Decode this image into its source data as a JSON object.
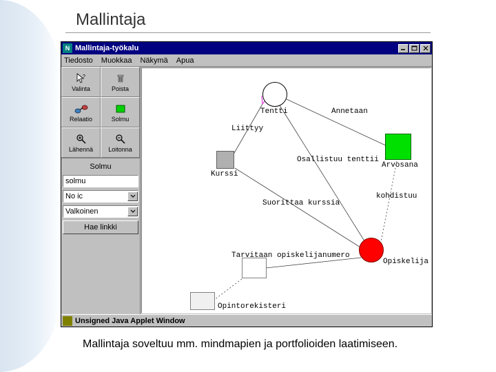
{
  "slide": {
    "title": "Mallintaja",
    "caption": "Mallintaja soveltuu mm. mindmapien ja portfolioiden laatimiseen."
  },
  "window": {
    "title": "Mallintaja-työkalu",
    "menus": [
      "Tiedosto",
      "Muokkaa",
      "Näkymä",
      "Apua"
    ],
    "statusbar": "Unsigned Java Applet Window"
  },
  "tools": {
    "valinta": "Valinta",
    "poista": "Poista",
    "relaatio": "Relaatio",
    "solmu": "Solmu",
    "lahenna": "Lähennä",
    "loitonna": "Loitonna"
  },
  "props": {
    "section": "Solmu",
    "nodeName": "solmu",
    "selectA": "No ic",
    "selectB": "Valkoinen",
    "fetchBtn": "Hae linkki"
  },
  "canvas": {
    "tentti": "Tentti",
    "annetaan": "Annetaan",
    "liittyy": "Liittyy",
    "arvosana": "Arvosana",
    "osallistuu": "Osallistuu tenttii",
    "kohdistuu": "kohdistuu",
    "kurssi": "Kurssi",
    "suorittaa": "Suorittaa kurssia",
    "tarvitaan": "Tarvitaan opiskelijanumero",
    "opiskelija": "Opiskelija",
    "opintorekisteri": "Opintorekisteri"
  }
}
